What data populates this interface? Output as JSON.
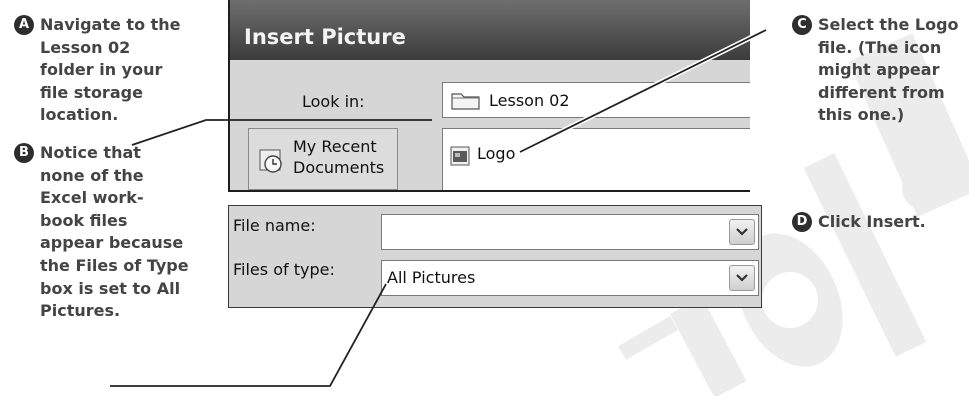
{
  "dialog": {
    "title": "Insert Picture",
    "look_in_label": "Look in:",
    "look_in_value": "Lesson 02",
    "places": {
      "my_recent_documents": [
        "My Recent",
        "Documents"
      ]
    },
    "files": [
      {
        "name": "Logo",
        "icon": "picture-file-icon"
      }
    ],
    "file_name_label": "File name:",
    "file_name_value": "",
    "files_of_type_label": "Files of type:",
    "files_of_type_value": "All Pictures"
  },
  "callouts": {
    "a": {
      "letter": "A",
      "lines": [
        "Navigate to the",
        "Lesson 02",
        "folder in your",
        "file storage",
        "location."
      ]
    },
    "b": {
      "letter": "B",
      "lines": [
        "Notice that",
        "none of the",
        "Excel work-",
        "book files",
        "appear because",
        "the Files of Type",
        "box is set to All",
        "Pictures."
      ]
    },
    "c": {
      "letter": "C",
      "lines": [
        "Select the Logo",
        "file. (The icon",
        "might appear",
        "different from",
        "this one.)"
      ]
    },
    "d": {
      "letter": "D",
      "lines": [
        "Click Insert."
      ]
    }
  },
  "colors": {
    "callout_text": "#444444",
    "badge": "#2e2e2e",
    "dialog_bg": "#d6d6d6",
    "title_bar": "#4a4a4a",
    "watermark": "#ebebeb"
  }
}
